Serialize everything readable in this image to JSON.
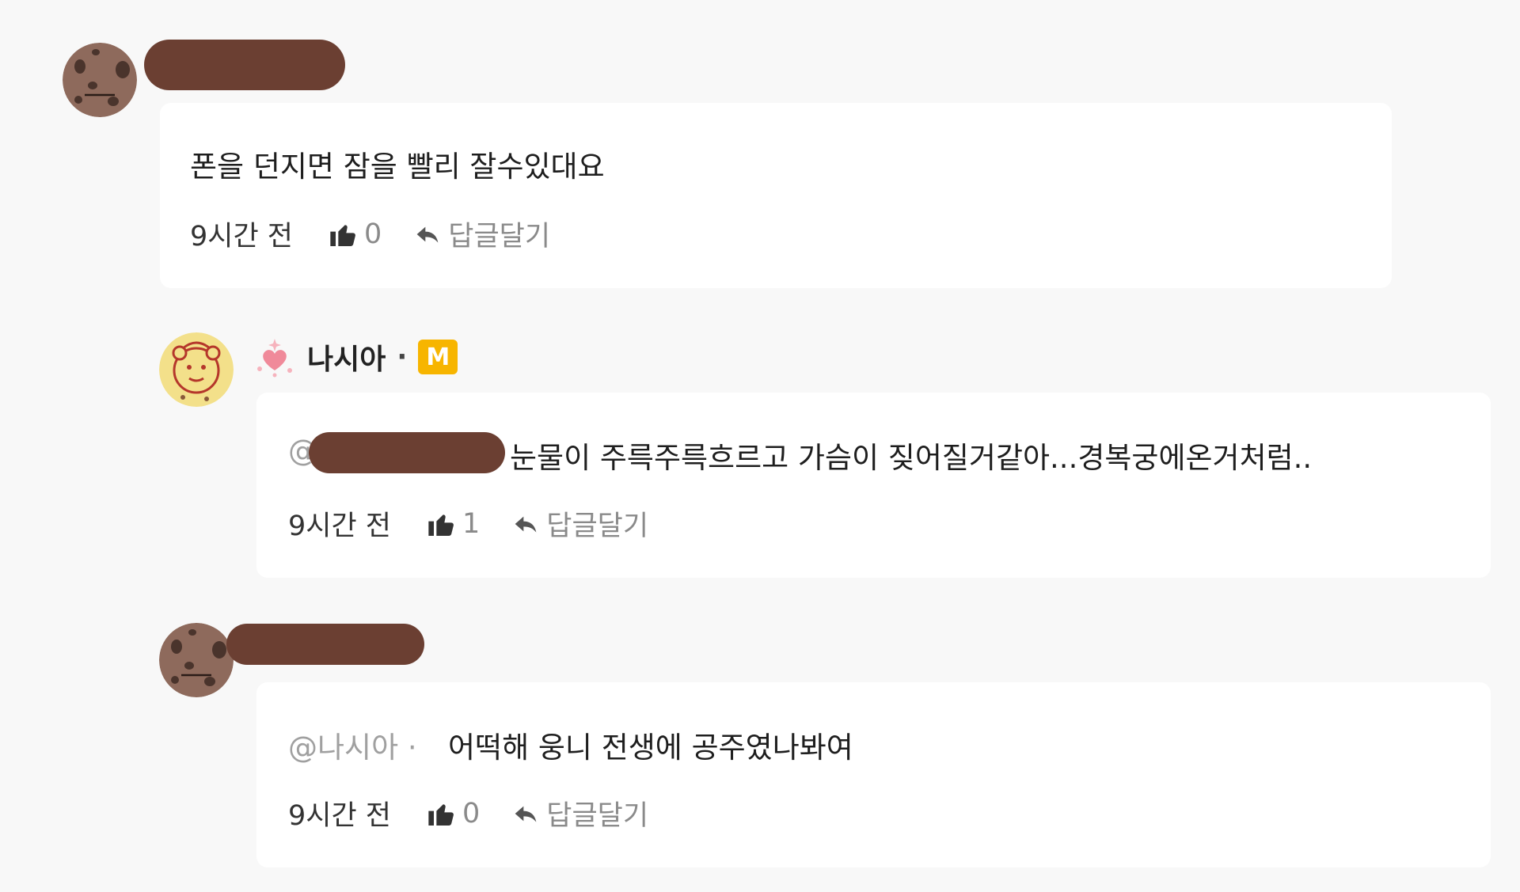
{
  "comments": [
    {
      "author": "",
      "text": "폰을 던지면 잠을 빨리 잘수있대요",
      "time": "9시간 전",
      "likes": "0",
      "reply_label": "답글달기",
      "mention": ""
    },
    {
      "author": "나시아",
      "author_separator": "·",
      "badge": "M",
      "mention": "@",
      "text": "눈물이 주륵주륵흐르고 가슴이 짖어질거같아...경복궁에온거처럼..",
      "time": "9시간 전",
      "likes": "1",
      "reply_label": "답글달기"
    },
    {
      "author": "",
      "mention": "@나시아 ·",
      "text": "어떡해 웅니 전생에 공주였나봐여",
      "time": "9시간 전",
      "likes": "0",
      "reply_label": "답글달기"
    }
  ],
  "colors": {
    "background": "#f8f8f8",
    "card": "#ffffff",
    "redaction": "#6b3f32",
    "badge": "#f7b500",
    "muted": "#8a8a8a"
  },
  "icons": {
    "like": "thumbs-up-icon",
    "reply": "reply-arrow-icon",
    "heart": "sparkle-heart-icon"
  }
}
